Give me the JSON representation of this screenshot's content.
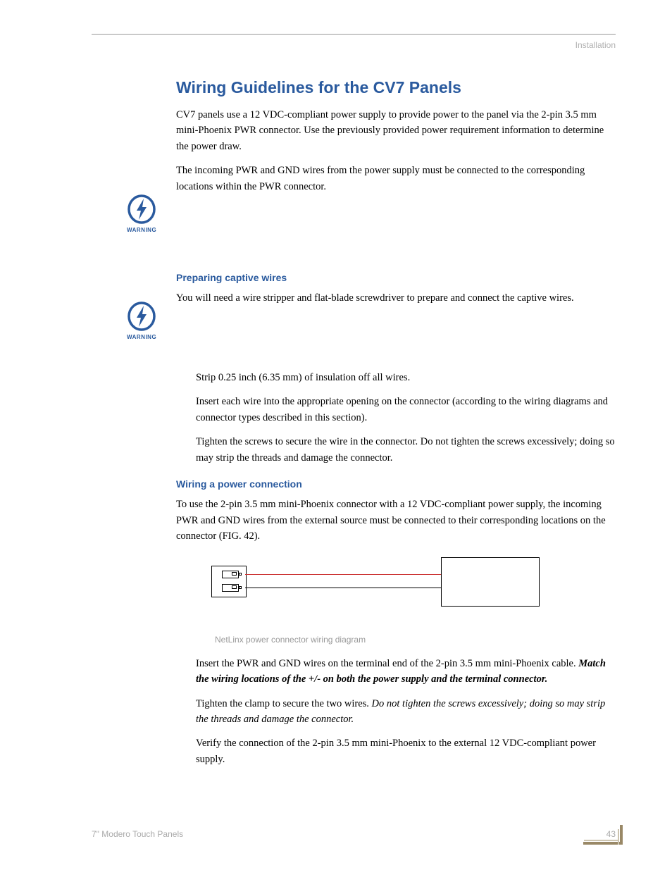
{
  "header": {
    "section_label": "Installation"
  },
  "title": "Wiring Guidelines for the CV7 Panels",
  "intro": [
    "CV7 panels use a 12 VDC-compliant power supply to provide power to the panel via the 2-pin 3.5 mm mini-Phoenix PWR connector. Use the previously provided power requirement information to determine the power draw.",
    "The incoming PWR and GND wires from the power supply must be connected to the corresponding locations within the PWR connector."
  ],
  "warning_label": "WARNING",
  "sections": {
    "preparing": {
      "heading": "Preparing captive wires",
      "lead": "You will need a wire stripper and flat-blade screwdriver to prepare and connect the captive wires.",
      "steps": [
        "Strip 0.25 inch (6.35 mm) of insulation off all wires.",
        "Insert each wire into the appropriate opening on the connector (according to the wiring diagrams and connector types described in this section).",
        "Tighten the screws to secure the wire in the connector. Do not tighten the screws excessively; doing so may strip the threads and damage the connector."
      ]
    },
    "wiring_power": {
      "heading": "Wiring a power connection",
      "lead": "To use the 2-pin 3.5 mm mini-Phoenix connector with a 12 VDC-compliant power supply, the incoming PWR and GND wires from the external source must be connected to their corresponding locations on the connector (FIG. 42).",
      "figure_caption": "NetLinx power connector wiring diagram",
      "step1_plain": "Insert the PWR and GND wires on the terminal end of the 2-pin 3.5 mm mini-Phoenix cable. ",
      "step1_bold_italic": "Match the wiring locations of the +/- on both the power supply and the terminal connector.",
      "step2_plain": "Tighten the clamp to secure the two wires. ",
      "step2_italic": "Do not tighten the screws excessively; doing so may strip the threads and damage the connector.",
      "step3": "Verify the connection of the 2-pin 3.5 mm mini-Phoenix to the external 12 VDC-compliant power supply."
    }
  },
  "footer": {
    "doc_title": "7\" Modero Touch Panels",
    "page_number": "43"
  }
}
